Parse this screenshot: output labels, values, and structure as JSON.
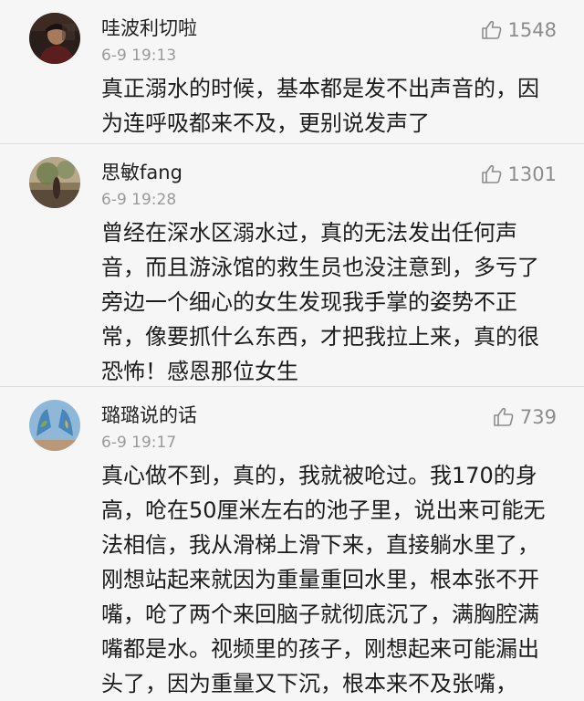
{
  "comments": [
    {
      "username": "哇波利切啦",
      "time": "6-9 19:13",
      "likes": "1548",
      "text_lines": [
        "真正溺水的时候，基本都是发不出声音的，因",
        "为连呼吸都来不及，更别说发声了"
      ]
    },
    {
      "username": "思敏fang",
      "time": "6-9 19:28",
      "likes": "1301",
      "text_lines": [
        "曾经在深水区溺水过，真的无法发出任何声",
        "音，而且游泳馆的救生员也没注意到，多亏了",
        "旁边一个细心的女生发现我手掌的姿势不正",
        "常，像要抓什么东西，才把我拉上来，真的很",
        "恐怖！感恩那位女生"
      ]
    },
    {
      "username": "璐璐说的话",
      "time": "6-9 19:17",
      "likes": "739",
      "text_lines": [
        "真心做不到，真的，我就被呛过。我170的身",
        "高，呛在50厘米左右的池子里，说出来可能无",
        "法相信，我从滑梯上滑下来，直接躺水里了，",
        "刚想站起来就因为重量重回水里，根本张不开",
        "嘴，呛了两个来回脑子就彻底沉了，满胸腔满",
        "嘴都是水。视频里的孩子，刚想起来可能漏出",
        "头了，因为重量又下沉，根本来不及张嘴，"
      ]
    }
  ],
  "icons": {
    "like": "thumbs-up-icon"
  }
}
